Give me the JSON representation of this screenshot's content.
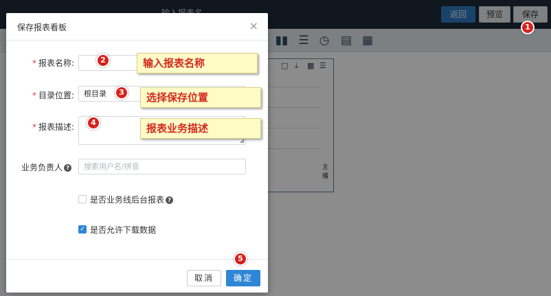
{
  "background": {
    "title": "输入报表名",
    "buttons": {
      "back": "返回",
      "preview": "预览",
      "save": "保存"
    },
    "canvas_text": "主播"
  },
  "dialog": {
    "title": "保存报表看板",
    "close_glyph": "×",
    "fields": {
      "name": {
        "label": "报表名称:",
        "value": ""
      },
      "location": {
        "label": "目录位置:",
        "value": "根目录"
      },
      "description": {
        "label": "报表描述:",
        "value": ""
      },
      "owner": {
        "label": "业务负责人",
        "placeholder": "搜索用户名/拼音"
      }
    },
    "checkboxes": {
      "backend_report": {
        "label": "是否业务线后台报表",
        "checked": false
      },
      "allow_download": {
        "label": "是否允许下载数据",
        "checked": true
      }
    },
    "buttons": {
      "cancel": "取消",
      "ok": "确定"
    }
  },
  "annotations": {
    "badges": [
      "1",
      "2",
      "3",
      "4",
      "5"
    ],
    "callouts": {
      "name": "输入报表名称",
      "location": "选择保存位置",
      "description": "报表业务描述"
    }
  },
  "colors": {
    "accent": "#2f86d6",
    "badge": "#d9201b",
    "callout_bg": "#fffbc7",
    "callout_text": "#d32a1e",
    "topbar": "#1e2b3a"
  },
  "icons": [
    "close-icon",
    "help-icon",
    "check-icon",
    "resize-grip-icon",
    "columns-icon",
    "rows-icon",
    "gauge-icon",
    "list-icon",
    "table-icon",
    "file-icon",
    "download-icon",
    "save-icon",
    "menu-icon"
  ]
}
